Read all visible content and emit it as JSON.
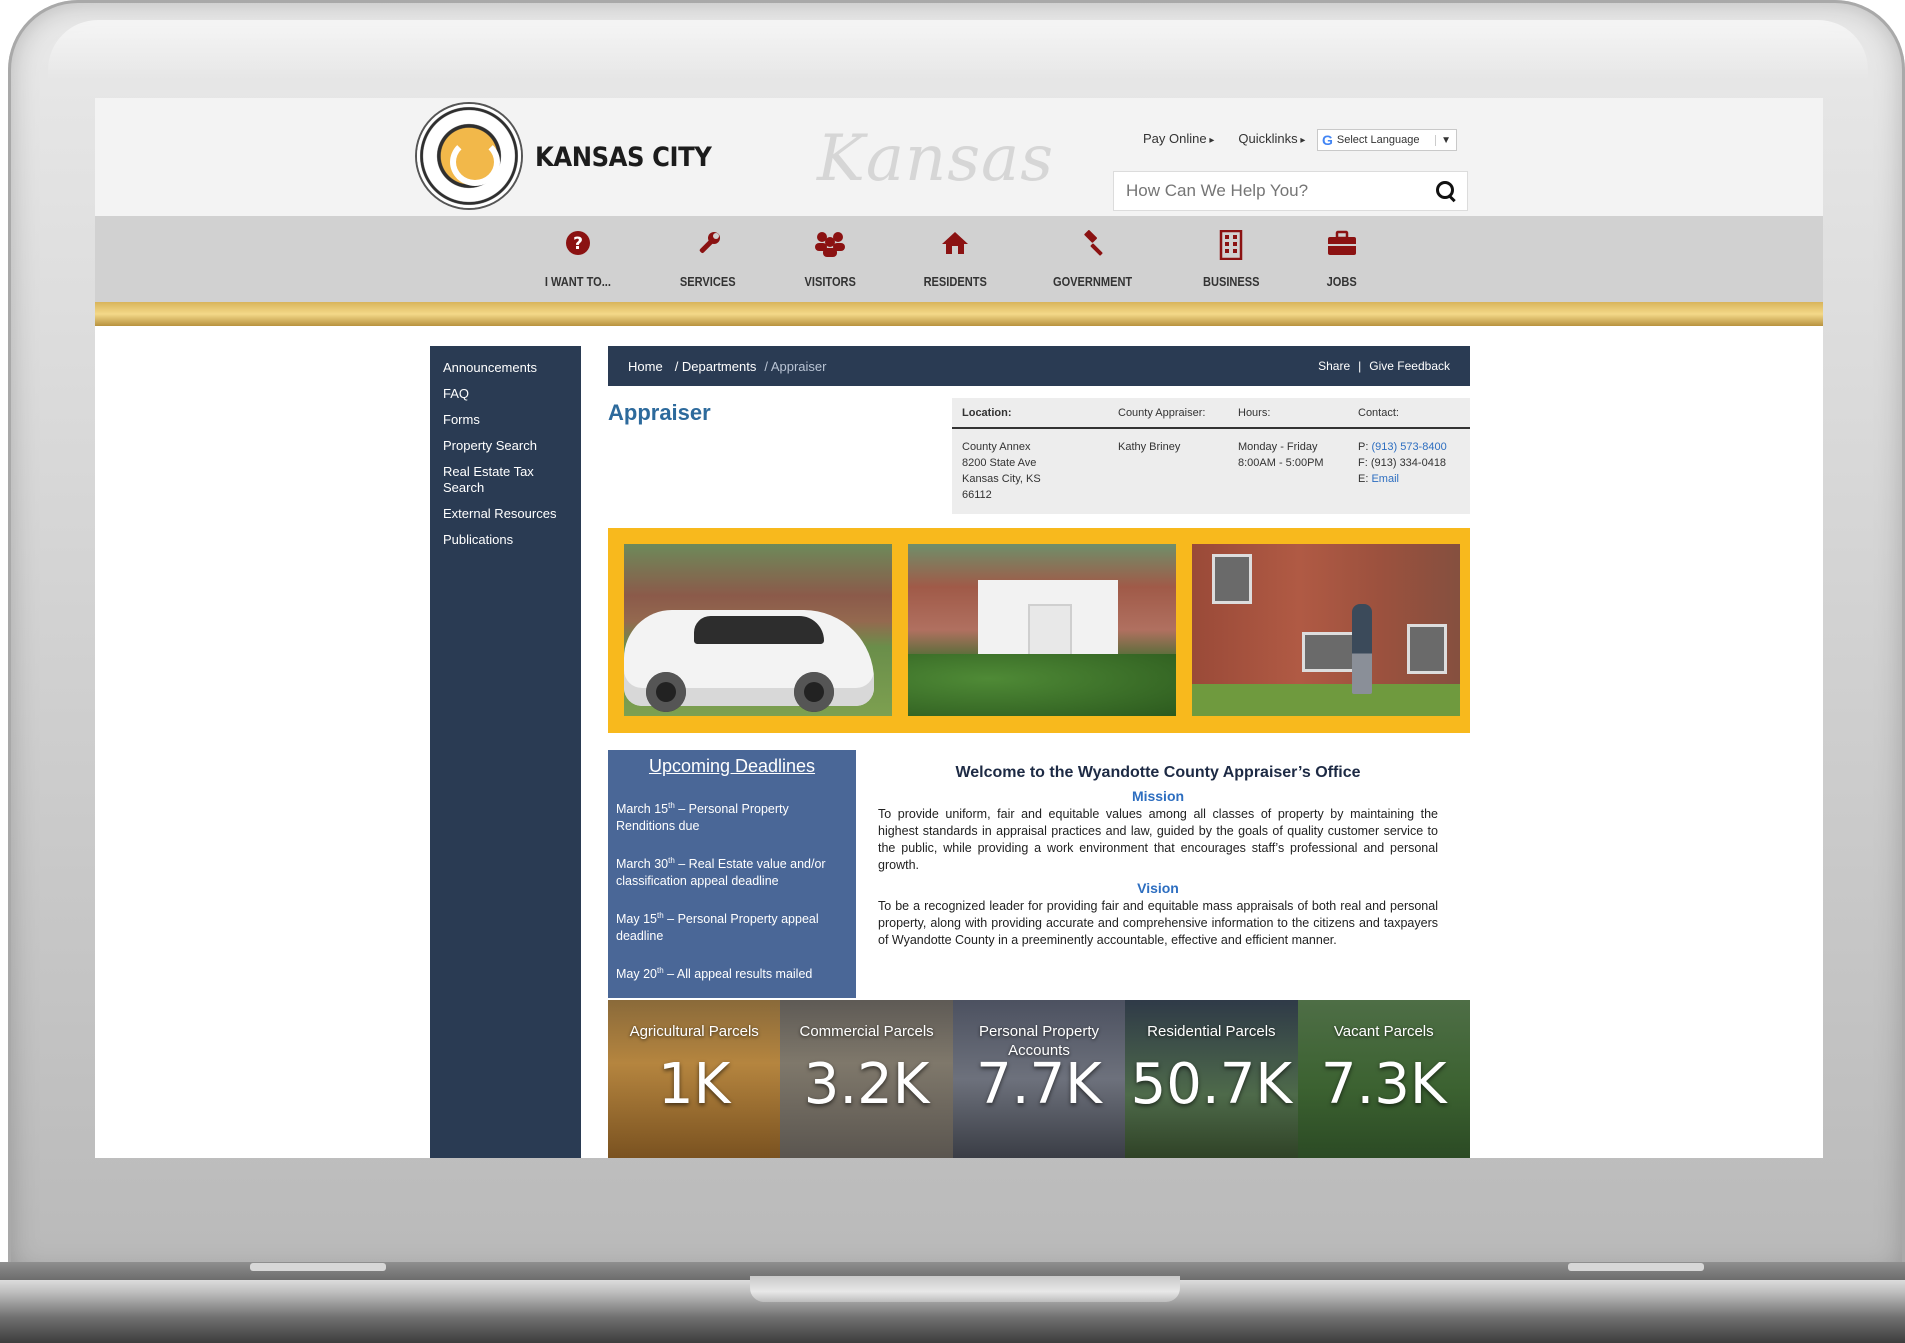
{
  "header": {
    "logo_text": "KANSAS CITY",
    "watermark": "Kansas",
    "pay_online": "Pay Online",
    "quicklinks": "Quicklinks",
    "language_select": "Select Language",
    "search_placeholder": "How Can We Help You?"
  },
  "nav": [
    {
      "label": "I WANT TO...",
      "icon": "question-circle-icon"
    },
    {
      "label": "SERVICES",
      "icon": "wrench-icon"
    },
    {
      "label": "VISITORS",
      "icon": "users-icon"
    },
    {
      "label": "RESIDENTS",
      "icon": "home-icon"
    },
    {
      "label": "GOVERNMENT",
      "icon": "gavel-icon"
    },
    {
      "label": "BUSINESS",
      "icon": "building-icon"
    },
    {
      "label": "JOBS",
      "icon": "briefcase-icon"
    }
  ],
  "sidebar": {
    "items": [
      "Announcements",
      "FAQ",
      "Forms",
      "Property Search",
      "Real Estate Tax Search",
      "External Resources",
      "Publications"
    ]
  },
  "breadcrumb": {
    "home": "Home",
    "departments": "/ Departments",
    "current": "/ Appraiser",
    "share": "Share",
    "feedback": "Give Feedback"
  },
  "page_title": "Appraiser",
  "info": {
    "headers": [
      "Location:",
      "County Appraiser:",
      "Hours:",
      "Contact:"
    ],
    "location": [
      "County Annex",
      "8200 State Ave",
      "Kansas City, KS",
      "66112"
    ],
    "appraiser": "Kathy Briney",
    "hours": [
      "Monday - Friday",
      "8:00AM - 5:00PM"
    ],
    "phone_label": "P:",
    "phone": "(913) 573-8400",
    "fax": "F: (913) 334-0418",
    "email_label": "E:",
    "email": "Email"
  },
  "deadlines": {
    "title": "Upcoming Deadlines",
    "items": [
      {
        "pre": "March 15",
        "sup": "th",
        "post": " – Personal Property Renditions due"
      },
      {
        "pre": "March 30",
        "sup": "th",
        "post": " – Real Estate value and/or classification appeal deadline"
      },
      {
        "pre": "May 15",
        "sup": "th",
        "post": " – Personal Property appeal deadline"
      },
      {
        "pre": "May 20",
        "sup": "th",
        "post": " – All appeal results mailed"
      }
    ]
  },
  "welcome": {
    "title": "Welcome to the Wyandotte County Appraiser’s Office",
    "mission_heading": "Mission",
    "mission": "To provide uniform, fair and equitable values among all classes of property by maintaining the highest standards in appraisal practices and law, guided by the goals of quality customer service to the public, while providing a work environment that encourages staff’s professional and personal growth.",
    "vision_heading": "Vision",
    "vision": "To be a recognized leader for providing fair and equitable mass appraisals of both real and personal property, along with providing accurate and comprehensive information to the citizens and taxpayers of Wyandotte County in a preeminently accountable, effective and efficient manner."
  },
  "stats": [
    {
      "label": "Agricultural Parcels",
      "value": "1K"
    },
    {
      "label": "Commercial Parcels",
      "value": "3.2K"
    },
    {
      "label": "Personal Property Accounts",
      "value": "7.7K"
    },
    {
      "label": "Residential Parcels",
      "value": "50.7K"
    },
    {
      "label": "Vacant Parcels",
      "value": "7.3K"
    }
  ],
  "colors": {
    "navy": "#2a3b53",
    "gold": "#f8b91d",
    "accent_blue": "#2d6ec0",
    "icon_red": "#8b1212"
  }
}
